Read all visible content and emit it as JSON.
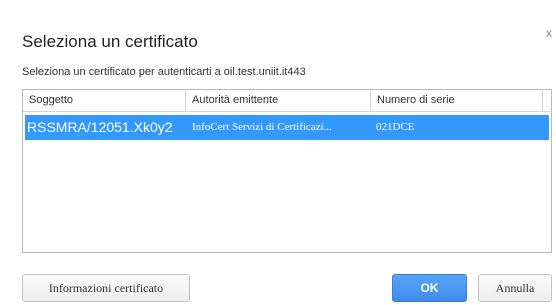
{
  "dialog": {
    "title": "Seleziona un certificato",
    "close_label": "x",
    "subtitle": "Seleziona un certificato per autenticarti a oil.test.uniit.it443"
  },
  "table": {
    "columns": [
      "Soggetto",
      "Autorità emittente",
      "Numero di serie",
      ""
    ],
    "rows": [
      {
        "subject": "RSSMRA/12051.Xk0y2",
        "issuer": "InfoCert Servizi di Certificazi...",
        "serial": "021DCE",
        "selected": true
      }
    ]
  },
  "buttons": {
    "info": "Informazioni certificato",
    "ok": "OK",
    "cancel": "Annulla"
  },
  "colors": {
    "selection": "#3399ff",
    "ok_button": "#4a96ef"
  }
}
